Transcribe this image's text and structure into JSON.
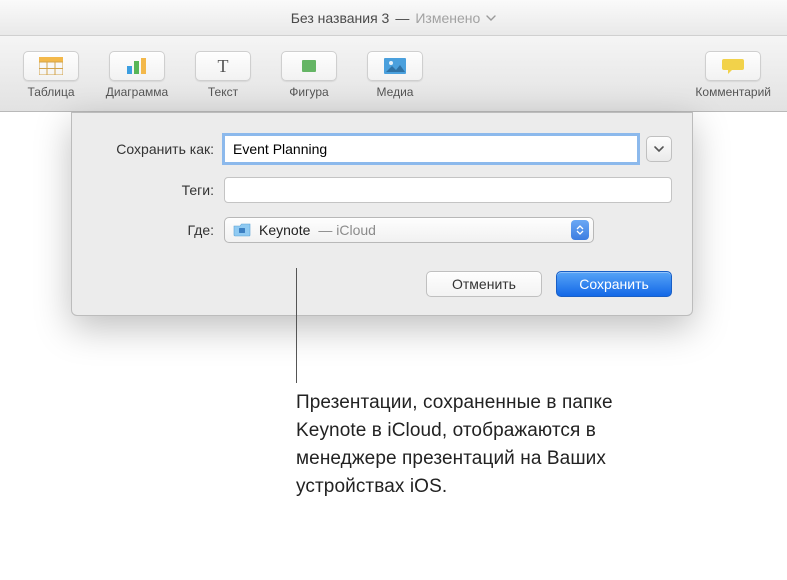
{
  "titlebar": {
    "title": "Без названия 3",
    "status": "Изменено"
  },
  "toolbar": {
    "items": [
      {
        "name": "table",
        "label": "Таблица"
      },
      {
        "name": "chart",
        "label": "Диаграмма"
      },
      {
        "name": "text",
        "label": "Текст"
      },
      {
        "name": "shape",
        "label": "Фигура"
      },
      {
        "name": "media",
        "label": "Медиа"
      },
      {
        "name": "comment",
        "label": "Комментарий"
      }
    ]
  },
  "sheet": {
    "save_as_label": "Сохранить как:",
    "save_as_value": "Event Planning",
    "tags_label": "Теги:",
    "tags_value": "",
    "where_label": "Где:",
    "where_value": "Keynote",
    "where_sub": " — iCloud",
    "cancel_label": "Отменить",
    "save_label": "Сохранить"
  },
  "callout": {
    "text": "Презентации, сохраненные в папке Keynote в iCloud, отображаются в менеджере презентаций на Ваших устройствах iOS."
  }
}
